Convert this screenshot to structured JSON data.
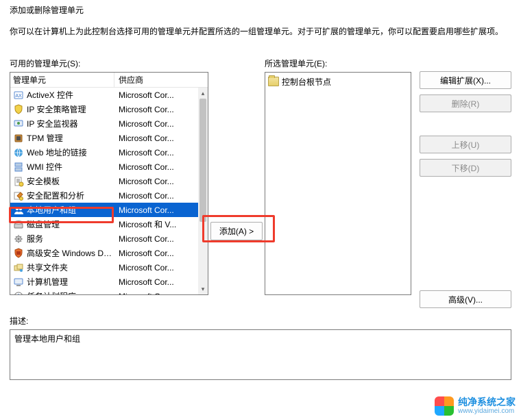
{
  "dialog": {
    "title": "添加或删除管理单元",
    "intro": "你可以在计算机上为此控制台选择可用的管理单元并配置所选的一组管理单元。对于可扩展的管理单元，你可以配置要启用哪些扩展项。"
  },
  "available": {
    "label": "可用的管理单元(S):",
    "header_name": "管理单元",
    "header_vendor": "供应商",
    "items": [
      {
        "name": "ActiveX 控件",
        "vendor": "Microsoft Cor...",
        "icon": "activex-icon"
      },
      {
        "name": "IP 安全策略管理",
        "vendor": "Microsoft Cor...",
        "icon": "shield-icon"
      },
      {
        "name": "IP 安全监视器",
        "vendor": "Microsoft Cor...",
        "icon": "monitor-icon"
      },
      {
        "name": "TPM 管理",
        "vendor": "Microsoft Cor...",
        "icon": "chip-icon"
      },
      {
        "name": "Web 地址的链接",
        "vendor": "Microsoft Cor...",
        "icon": "link-icon"
      },
      {
        "name": "WMI 控件",
        "vendor": "Microsoft Cor...",
        "icon": "server-icon"
      },
      {
        "name": "安全模板",
        "vendor": "Microsoft Cor...",
        "icon": "template-icon"
      },
      {
        "name": "安全配置和分析",
        "vendor": "Microsoft Cor...",
        "icon": "config-icon"
      },
      {
        "name": "本地用户和组",
        "vendor": "Microsoft Cor...",
        "icon": "users-icon",
        "selected": true
      },
      {
        "name": "磁盘管理",
        "vendor": "Microsoft 和 V...",
        "icon": "disk-icon"
      },
      {
        "name": "服务",
        "vendor": "Microsoft Cor...",
        "icon": "gear-icon"
      },
      {
        "name": "高级安全 Windows De...",
        "vendor": "Microsoft Cor...",
        "icon": "firewall-icon"
      },
      {
        "name": "共享文件夹",
        "vendor": "Microsoft Cor...",
        "icon": "share-icon"
      },
      {
        "name": "计算机管理",
        "vendor": "Microsoft Cor...",
        "icon": "computer-icon"
      },
      {
        "name": "任务计划程序",
        "vendor": "Microsoft Cor...",
        "icon": "task-icon"
      }
    ]
  },
  "selected_panel": {
    "label": "所选管理单元(E):",
    "root": "控制台根节点"
  },
  "buttons": {
    "add": "添加(A) >",
    "edit_ext": "编辑扩展(X)...",
    "remove": "删除(R)",
    "move_up": "上移(U)",
    "move_down": "下移(D)",
    "advanced": "高级(V)..."
  },
  "description": {
    "label": "描述:",
    "text": "管理本地用户和组"
  },
  "watermark": {
    "line1": "纯净系统之家",
    "line2": "www.yidaimei.com"
  },
  "colors": {
    "selection": "#0a64d1",
    "annotation": "#ef3b2c"
  }
}
